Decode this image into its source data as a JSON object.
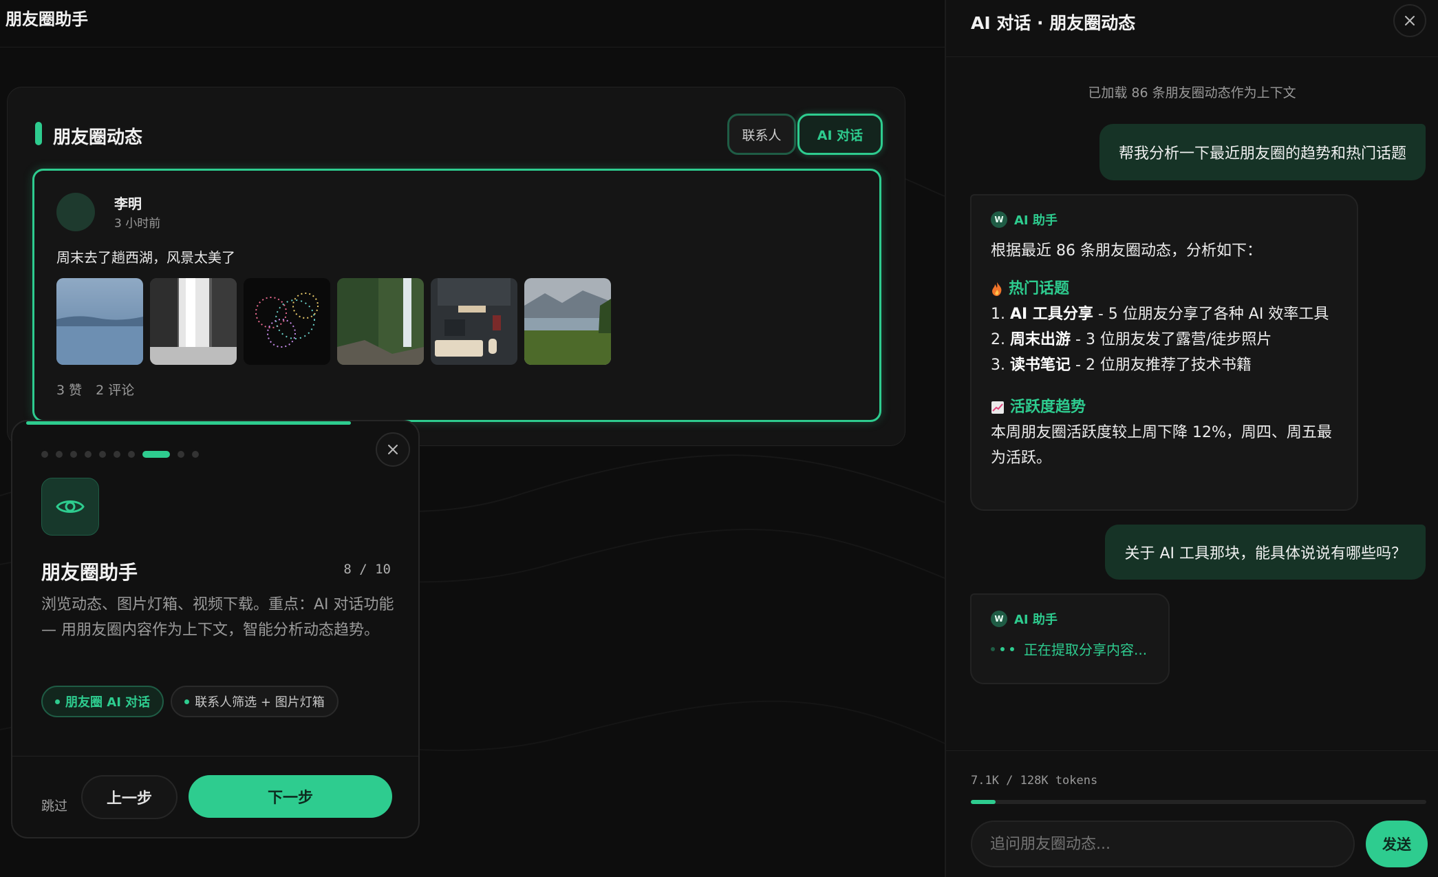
{
  "app": {
    "title": "朋友圈助手"
  },
  "feed": {
    "title": "朋友圈动态",
    "tabs": [
      {
        "label": "联系人"
      },
      {
        "label": "AI 对话"
      }
    ],
    "post": {
      "author": "李明",
      "time": "3 小时前",
      "text": "周末去了趟西湖，风景太美了",
      "photos": [
        "lake-photo",
        "waterfall-photo",
        "fireworks-photo",
        "forest-waterfall-photo",
        "desk-setup-photo",
        "mountain-lake-photo"
      ],
      "likes": "3 赞",
      "comments": "2 评论"
    }
  },
  "tour": {
    "progress": 0.8,
    "dots_total": 10,
    "dot_active": 8,
    "title": "朋友圈助手",
    "step": "8 / 10",
    "description": "浏览动态、图片灯箱、视频下载。重点：AI 对话功能 — 用朋友圈内容作为上下文，智能分析动态趋势。",
    "chips": [
      {
        "label": "朋友圈 AI 对话"
      },
      {
        "label": "联系人筛选 + 图片灯箱"
      }
    ],
    "skip_label": "跳过",
    "prev_label": "上一步",
    "next_label": "下一步"
  },
  "chat": {
    "title": "AI 对话 · 朋友圈动态",
    "context_note": "已加载 86 条朋友圈动态作为上下文",
    "assistant_name": "AI 助手",
    "assistant_badge": "W",
    "user_message_1": "帮我分析一下最近朋友圈的趋势和热门话题",
    "ai_reply_1": {
      "intro": "根据最近 86 条朋友圈动态，分析如下：",
      "hot_title": "热门话题",
      "hot_items": [
        {
          "num": "1.",
          "bold": "AI 工具分享",
          "rest": " - 5 位朋友分享了各种 AI 效率工具"
        },
        {
          "num": "2.",
          "bold": "周末出游",
          "rest": " - 3 位朋友发了露营/徒步照片"
        },
        {
          "num": "3.",
          "bold": "读书笔记",
          "rest": " - 2 位朋友推荐了技术书籍"
        }
      ],
      "trend_title": "活跃度趋势",
      "trend_text": "本周朋友圈活跃度较上周下降 12%，周四、周五最为活跃。"
    },
    "user_message_2": "关于 AI 工具那块，能具体说说有哪些吗？",
    "ai_typing": "正在提取分享内容...",
    "tokens": "7.1K / 128K tokens",
    "token_fraction": 0.055,
    "input_placeholder": "追问朋友圈动态...",
    "send_label": "发送"
  },
  "colors": {
    "accent": "#2ecc8f",
    "background": "#0d0d0d",
    "panel": "#141414"
  }
}
